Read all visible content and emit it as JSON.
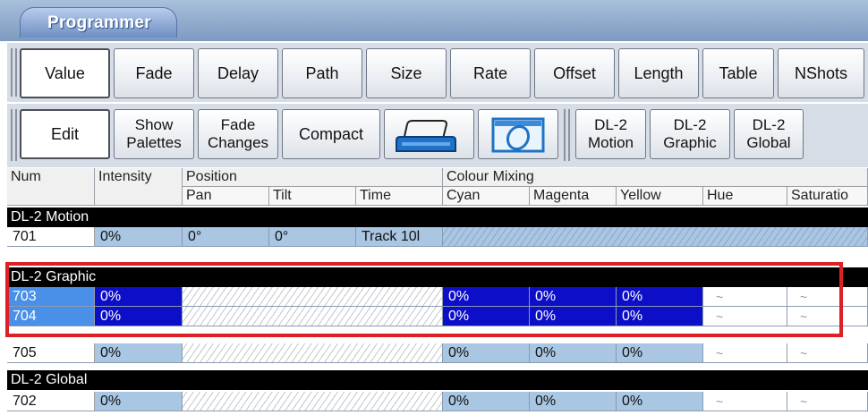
{
  "window": {
    "title": "Programmer"
  },
  "toolbar1": {
    "buttons": [
      "Value",
      "Fade",
      "Delay",
      "Path",
      "Size",
      "Rate",
      "Offset",
      "Length",
      "Table",
      "NShots"
    ],
    "active": "Value"
  },
  "toolbar2": {
    "edit": "Edit",
    "show_palettes": [
      "Show",
      "Palettes"
    ],
    "fade_changes": [
      "Fade",
      "Changes"
    ],
    "compact": "Compact",
    "dl2_motion": [
      "DL-2",
      "Motion"
    ],
    "dl2_graphic": [
      "DL-2",
      "Graphic"
    ],
    "dl2_global": [
      "DL-2",
      "Global"
    ],
    "icons": [
      "printer-icon",
      "lens-icon"
    ]
  },
  "grid": {
    "group_headers": {
      "num": "Num",
      "intensity": "Intensity",
      "position": "Position",
      "colour_mixing": "Colour Mixing"
    },
    "columns": [
      "Pan",
      "Tilt",
      "Time",
      "Cyan",
      "Magenta",
      "Yellow",
      "Hue",
      "Saturatio"
    ],
    "groups": [
      {
        "name": "DL-2 Motion",
        "rows": [
          {
            "num": "701",
            "intensity": "0%",
            "pan": "0°",
            "tilt": "0°",
            "time": "Track 10l"
          }
        ]
      },
      {
        "name": "DL-2 Graphic",
        "rows": [
          {
            "num": "703",
            "intensity": "0%",
            "cyan": "0%",
            "magenta": "0%",
            "yellow": "0%",
            "hue": "~",
            "saturation": "~"
          },
          {
            "num": "704",
            "intensity": "0%",
            "cyan": "0%",
            "magenta": "0%",
            "yellow": "0%",
            "hue": "~",
            "saturation": "~"
          },
          {
            "num": "705",
            "intensity": "0%",
            "cyan": "0%",
            "magenta": "0%",
            "yellow": "0%",
            "hue": "~",
            "saturation": "~"
          }
        ]
      },
      {
        "name": "DL-2 Global",
        "rows": [
          {
            "num": "702",
            "intensity": "0%",
            "cyan": "0%",
            "magenta": "0%",
            "yellow": "0%",
            "hue": "~",
            "saturation": "~"
          }
        ]
      }
    ]
  },
  "colors": {
    "selected_cell": "#0d0ec8",
    "value_cell": "#a9c6e2",
    "highlight_box": "#dc2026",
    "selected_num": "#4a90e8"
  }
}
